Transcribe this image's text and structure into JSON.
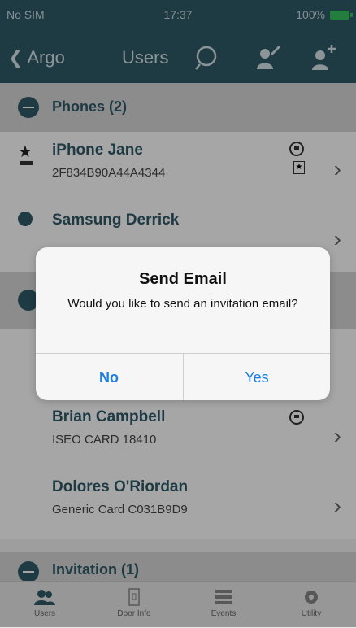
{
  "status": {
    "carrier": "No SIM",
    "time": "17:37",
    "battery": "100%"
  },
  "nav": {
    "back_label": "Argo",
    "title": "Users",
    "icons": [
      "search-icon",
      "edit-user-icon",
      "add-user-icon"
    ]
  },
  "sections": [
    {
      "label": "Phones (2)"
    },
    {
      "label": "Invitation (1)"
    }
  ],
  "rows": [
    {
      "title": "iPhone Jane",
      "subtitle": "2F834B90A44A4344"
    },
    {
      "title": "Samsung Derrick",
      "subtitle": ""
    },
    {
      "title": "Brian Campbell",
      "subtitle": "ISEO CARD 18410"
    },
    {
      "title": "Dolores O'Riordan",
      "subtitle": "Generic Card C031B9D9"
    }
  ],
  "dialog": {
    "title": "Send Email",
    "message": "Would you like to send an invitation email?",
    "no_label": "No",
    "yes_label": "Yes"
  },
  "tabbar": {
    "tabs": [
      {
        "label": "Users",
        "icon": "users-icon"
      },
      {
        "label": "Door Info",
        "icon": "door-icon"
      },
      {
        "label": "Events",
        "icon": "list-icon"
      },
      {
        "label": "Utility",
        "icon": "gear-icon"
      }
    ]
  },
  "colors": {
    "primary": "#2f5a68",
    "accent": "#1a7fe3",
    "battery": "#37c15c"
  }
}
